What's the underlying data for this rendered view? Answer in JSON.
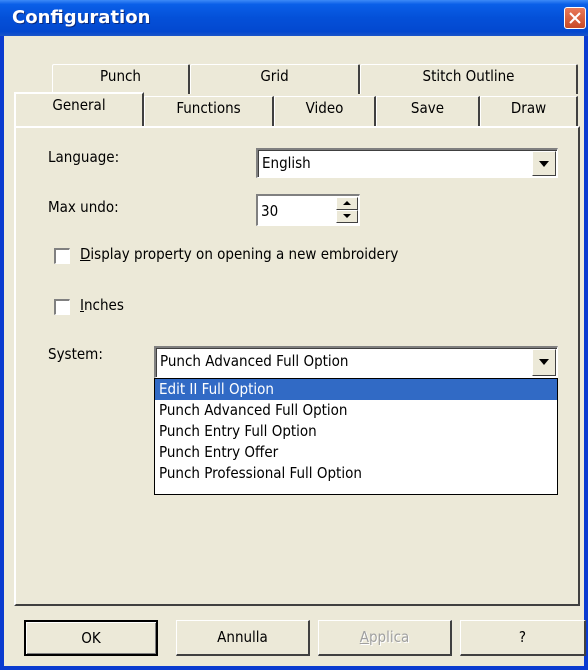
{
  "window": {
    "title": "Configuration"
  },
  "tabs": {
    "back_row": [
      "Punch",
      "Grid",
      "Stitch Outline"
    ],
    "front_row": [
      "General",
      "Functions",
      "Video",
      "Save",
      "Draw"
    ],
    "active": "General"
  },
  "general": {
    "language_label": "Language:",
    "language_value": "English",
    "max_undo_label": "Max undo:",
    "max_undo_value": "30",
    "display_property_mnemonic": "D",
    "display_property_rest": "isplay property on opening a new embroidery",
    "display_property_checked": false,
    "inches_mnemonic": "I",
    "inches_rest": "nches",
    "inches_checked": false,
    "system_label": "System:",
    "system_value": "Punch Advanced Full Option",
    "system_options": [
      "Edit II Full Option",
      "Punch Advanced Full Option",
      "Punch Entry Full Option",
      "Punch Entry Offer",
      "Punch Professional Full Option"
    ],
    "system_highlighted": "Edit II Full Option"
  },
  "buttons": {
    "ok": "OK",
    "cancel": "Annulla",
    "apply_mnemonic": "A",
    "apply_rest": "pplica",
    "help": "?"
  },
  "colors": {
    "titlebar": "#0450d8",
    "face": "#ece9d8",
    "selection": "#316ac5"
  }
}
